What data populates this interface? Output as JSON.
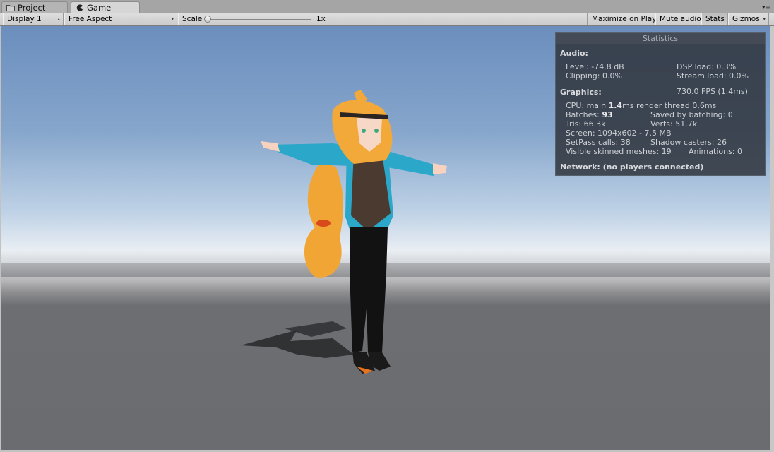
{
  "tabs": [
    {
      "label": "Project",
      "icon": "folder-icon",
      "active": false
    },
    {
      "label": "Game",
      "icon": "pacman-icon",
      "active": true
    }
  ],
  "toolbar": {
    "display": "Display 1",
    "aspect": "Free Aspect",
    "scale_label": "Scale",
    "scale_value": "1x",
    "scale_fraction": 0.0,
    "buttons": {
      "maximize": "Maximize on Play",
      "mute": "Mute audio",
      "stats": "Stats",
      "gizmos": "Gizmos"
    }
  },
  "stats": {
    "title": "Statistics",
    "audio_header": "Audio:",
    "level": "Level: -74.8 dB",
    "dsp": "DSP load: 0.3%",
    "clipping": "Clipping: 0.0%",
    "stream": "Stream load: 0.0%",
    "graphics_header": "Graphics:",
    "fps": "730.0 FPS (1.4ms)",
    "cpu_prefix": "CPU: main ",
    "cpu_main": "1.4",
    "cpu_suffix": "ms  render thread 0.6ms",
    "batches_prefix": "Batches: ",
    "batches": "93",
    "saved": "Saved by batching: 0",
    "tris": "Tris: 66.3k",
    "verts": "Verts: 51.7k",
    "screen": "Screen: 1094x602 - 7.5 MB",
    "setpass": "SetPass calls: 38",
    "shadow": "Shadow casters: 26",
    "skinned": "Visible skinned meshes: 19",
    "animations": "Animations: 0",
    "network": "Network: (no players connected)"
  },
  "colors": {
    "hair": "#f2a93a",
    "jacket": "#2aa7c9",
    "vest": "#4a3a30",
    "legs": "#121212"
  }
}
